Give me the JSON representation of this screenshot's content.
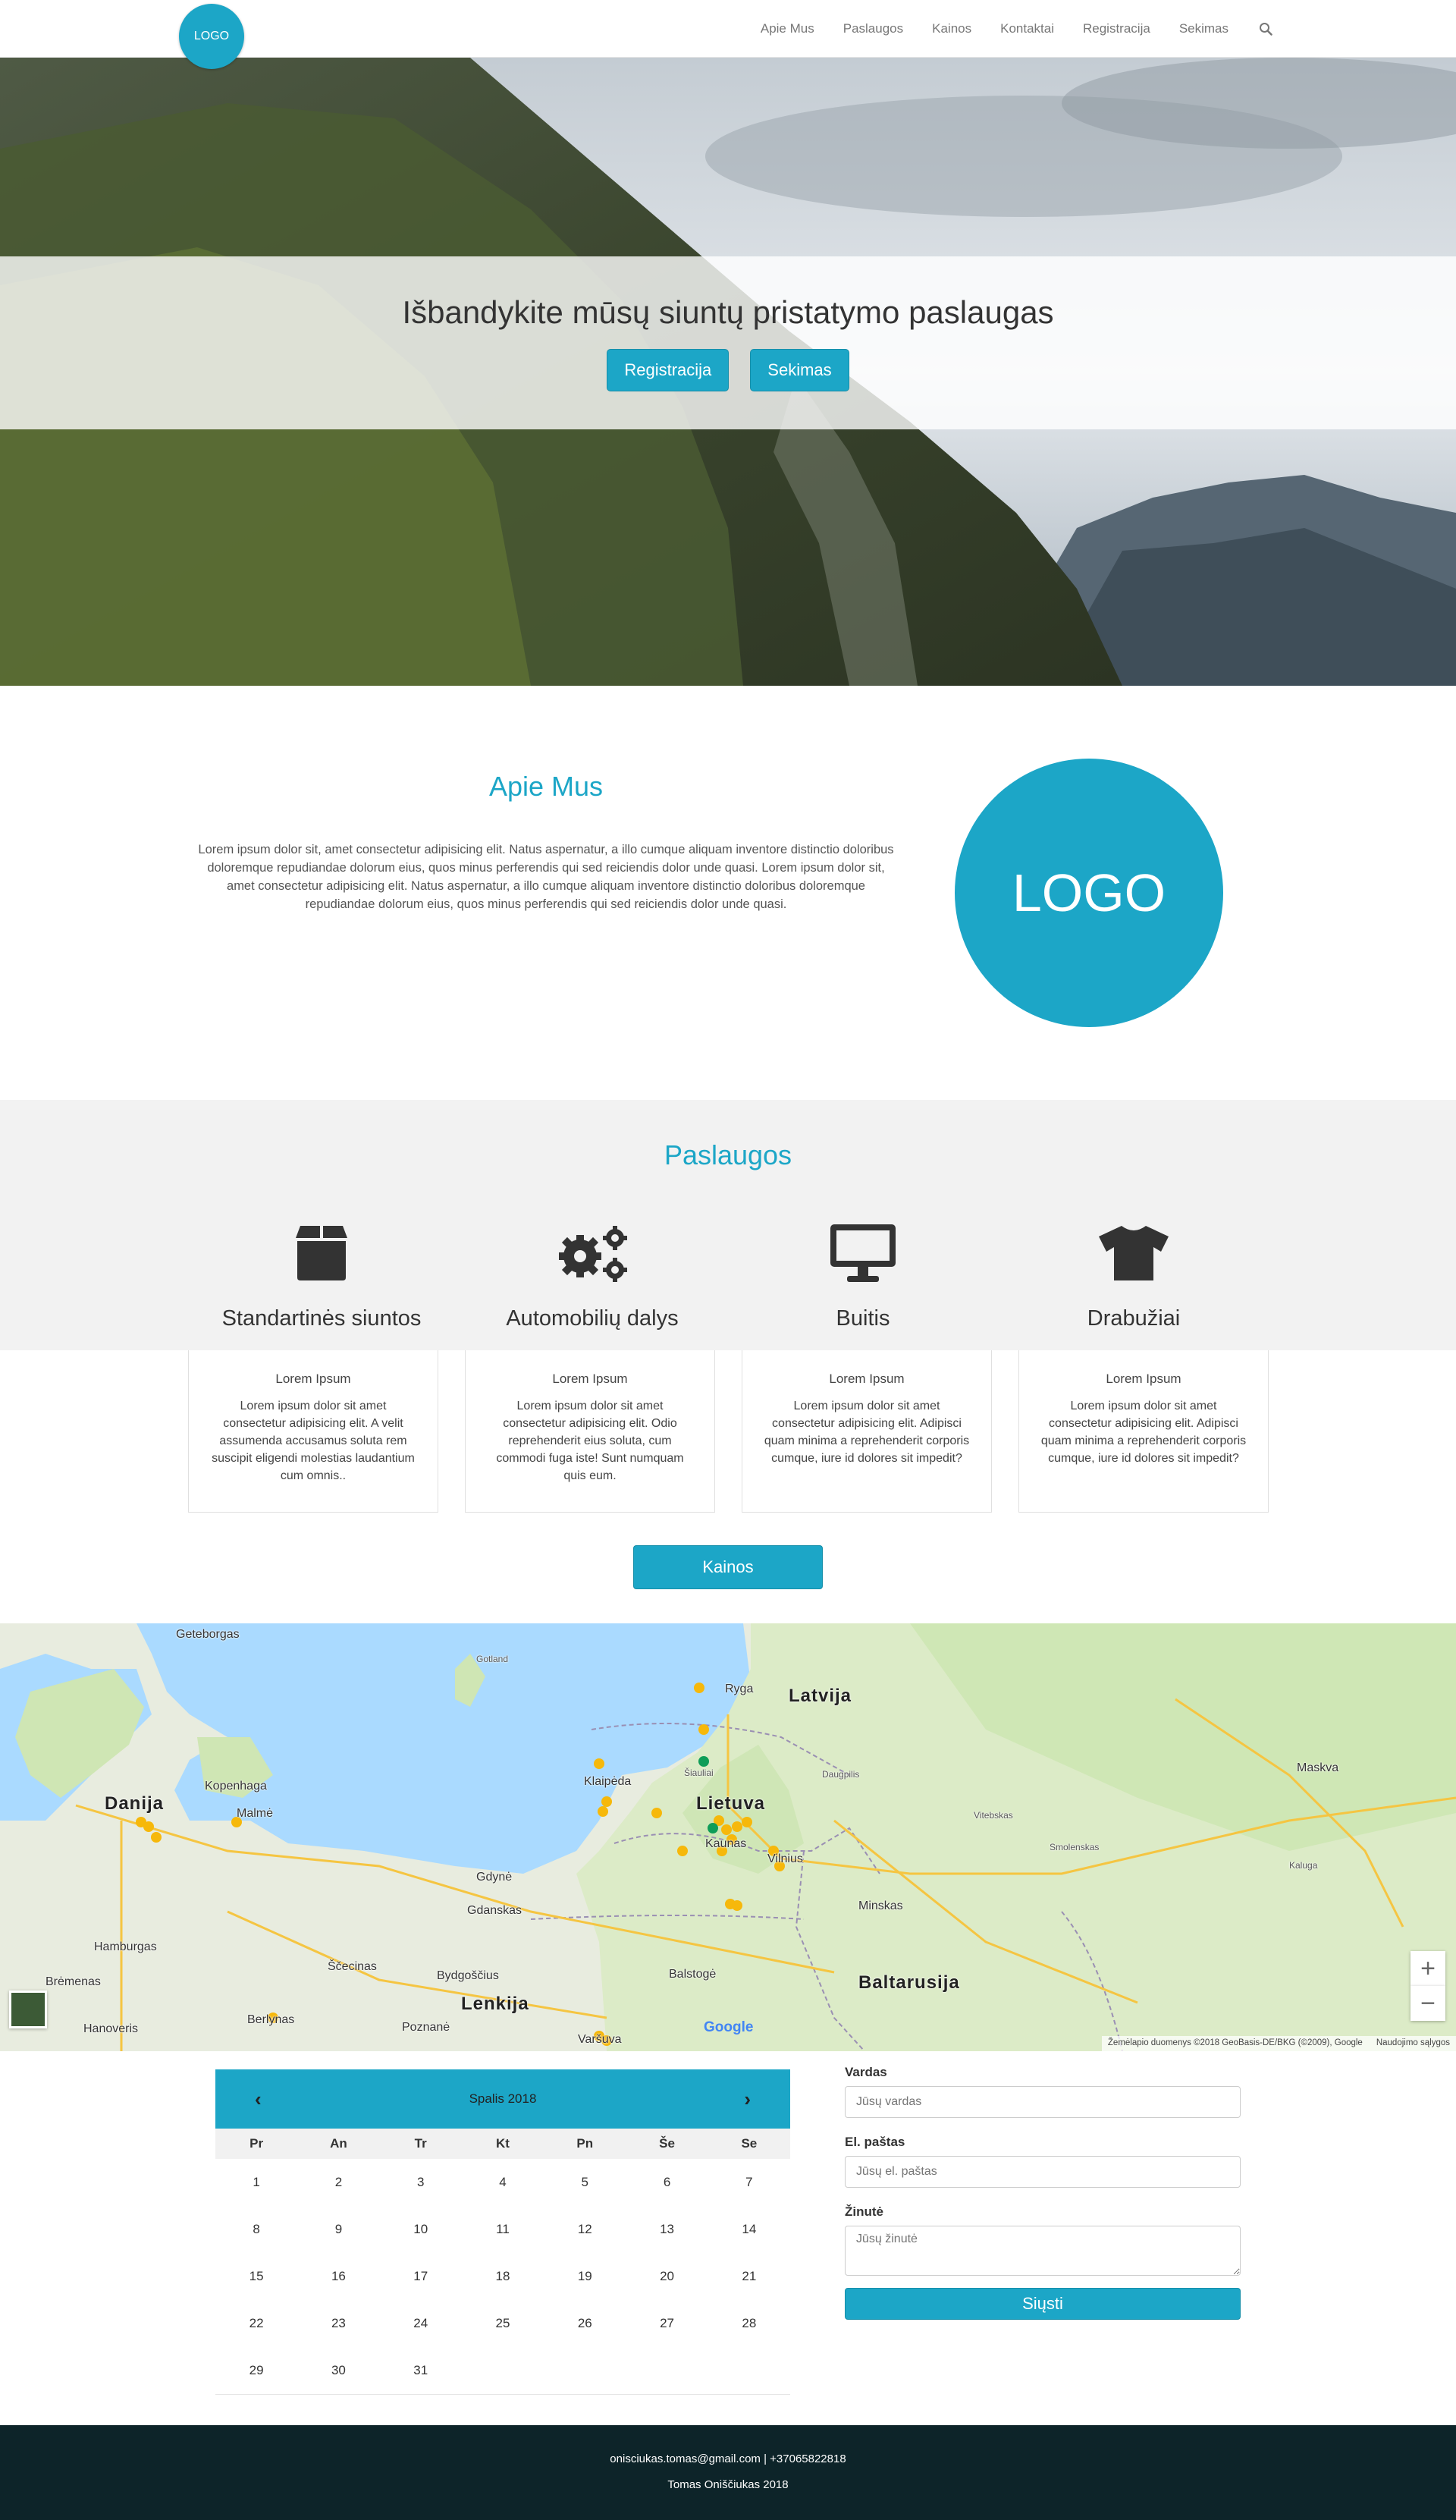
{
  "nav": {
    "logo": "LOGO",
    "links": [
      "Apie Mus",
      "Paslaugos",
      "Kainos",
      "Kontaktai",
      "Registracija",
      "Sekimas"
    ],
    "search_icon": "search-icon"
  },
  "hero": {
    "title": "Išbandykite mūsų siuntų pristatymo paslaugas",
    "buttons": [
      "Registracija",
      "Sekimas"
    ]
  },
  "about": {
    "title": "Apie Mus",
    "text": "Lorem ipsum dolor sit, amet consectetur adipisicing elit. Natus aspernatur, a illo cumque aliquam inventore distinctio doloribus doloremque repudiandae dolorum eius, quos minus perferendis qui sed reiciendis dolor unde quasi. Lorem ipsum dolor sit, amet consectetur adipisicing elit. Natus aspernatur, a illo cumque aliquam inventore distinctio doloribus doloremque repudiandae dolorum eius, quos minus perferendis qui sed reiciendis dolor unde quasi.",
    "logo": "LOGO"
  },
  "services": {
    "title": "Paslaugos",
    "items": [
      {
        "title": "Standartinės siuntos",
        "icon": "box-icon",
        "card_head": "Lorem Ipsum",
        "card_body": "Lorem ipsum dolor sit amet consectetur adipisicing elit. A velit assumenda accusamus soluta rem suscipit eligendi molestias laudantium cum omnis.."
      },
      {
        "title": "Automobilių dalys",
        "icon": "cogs-icon",
        "card_head": "Lorem Ipsum",
        "card_body": "Lorem ipsum dolor sit amet consectetur adipisicing elit. Odio reprehenderit eius soluta, cum commodi fuga iste! Sunt numquam quis eum."
      },
      {
        "title": "Buitis",
        "icon": "desktop-icon",
        "card_head": "Lorem Ipsum",
        "card_body": "Lorem ipsum dolor sit amet consectetur adipisicing elit. Adipisci quam minima a reprehenderit corporis cumque, iure id dolores sit impedit?"
      },
      {
        "title": "Drabužiai",
        "icon": "tshirt-icon",
        "card_head": "Lorem Ipsum",
        "card_body": "Lorem ipsum dolor sit amet consectetur adipisicing elit. Adipisci quam minima a reprehenderit corporis cumque, iure id dolores sit impedit?"
      }
    ],
    "prices_button": "Kainos"
  },
  "map": {
    "countries": [
      "Latvija",
      "Lietuva",
      "Danija",
      "Lenkija",
      "Baltarusija"
    ],
    "cities": [
      "Geteborgas",
      "Ryga",
      "Klaipėda",
      "Kaunas",
      "Vilnius",
      "Kopenhaga",
      "Malmė",
      "Gdynė",
      "Gdanskas",
      "Minskas",
      "Hamburgas",
      "Berlynas",
      "Varšuva",
      "Brėmenas",
      "Hanoveris",
      "Balstogė",
      "Bydgoščius",
      "Poznanė",
      "Ščecinas",
      "Daugpilis",
      "Šiauliai",
      "Gotland",
      "Maskva",
      "Kaluga",
      "Smolenskas",
      "Vitebskas"
    ],
    "attribution": "Žemėlapio duomenys ©2018 GeoBasis-DE/BKG (©2009), Google",
    "terms": "Naudojimo sąlygos",
    "google": "Google",
    "zoom_in": "+",
    "zoom_out": "−"
  },
  "calendar": {
    "month": "Spalis 2018",
    "prev": "‹",
    "next": "›",
    "weekdays": [
      "Pr",
      "An",
      "Tr",
      "Kt",
      "Pn",
      "Še",
      "Se"
    ],
    "days": [
      "1",
      "2",
      "3",
      "4",
      "5",
      "6",
      "7",
      "8",
      "9",
      "10",
      "11",
      "12",
      "13",
      "14",
      "15",
      "16",
      "17",
      "18",
      "19",
      "20",
      "21",
      "22",
      "23",
      "24",
      "25",
      "26",
      "27",
      "28",
      "29",
      "30",
      "31"
    ]
  },
  "form": {
    "name_label": "Vardas",
    "name_placeholder": "Jūsų vardas",
    "email_label": "El. paštas",
    "email_placeholder": "Jūsų el. paštas",
    "message_label": "Žinutė",
    "message_placeholder": "Jūsų žinutė",
    "submit": "Siųsti"
  },
  "footer": {
    "contact": "onisciukas.tomas@gmail.com | +37065822818",
    "copyright": "Tomas Oniščiukas 2018"
  },
  "colors": {
    "accent": "#1ca6c7",
    "footer_bg": "#0d2429",
    "section_bg": "#f2f2f2"
  }
}
